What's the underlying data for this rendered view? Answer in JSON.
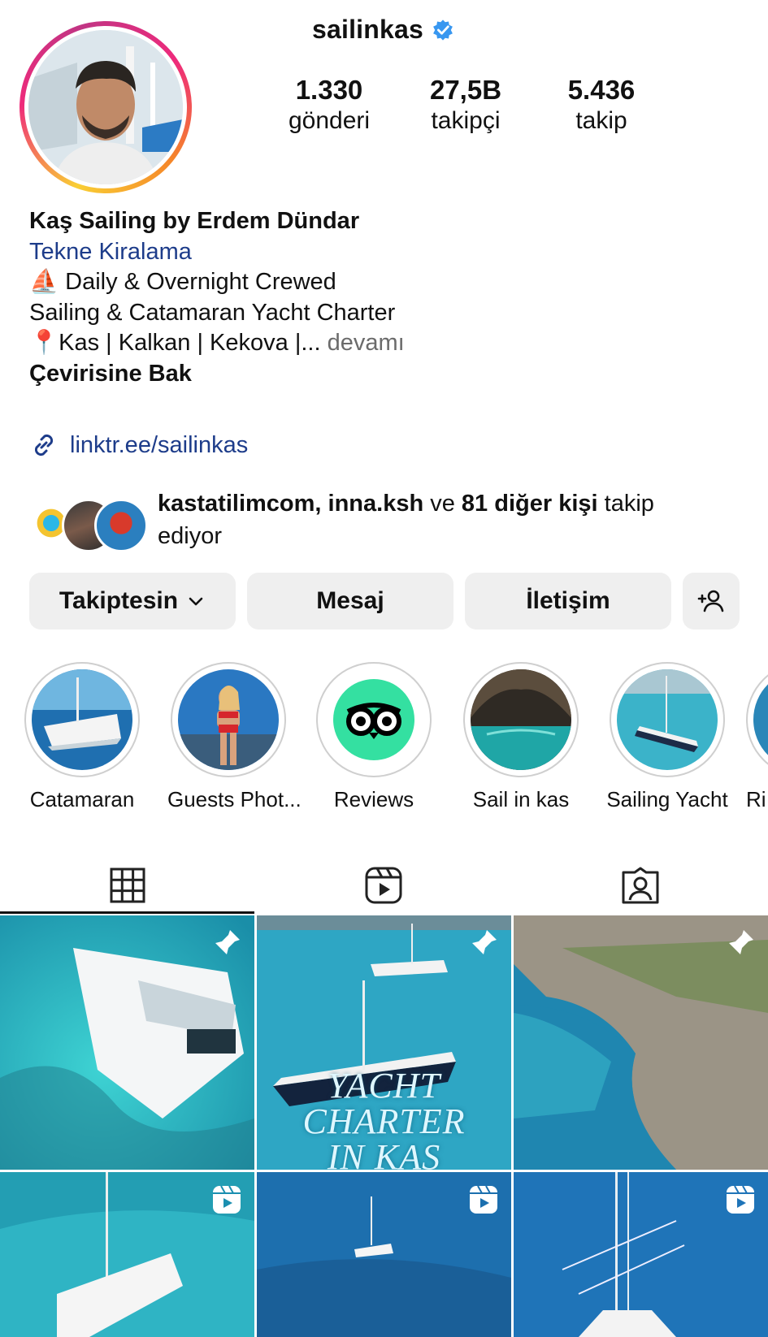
{
  "profile": {
    "username": "sailinkas",
    "verified": true,
    "stats": [
      {
        "value": "1.330",
        "label": "gönderi"
      },
      {
        "value": "27,5B",
        "label": "takipçi"
      },
      {
        "value": "5.436",
        "label": "takip"
      }
    ]
  },
  "bio": {
    "name": "Kaş Sailing by Erdem Dündar",
    "category": "Tekne Kiralama",
    "line1_icon": "sailboat-icon",
    "line1": "Daily & Overnight Crewed",
    "line2": "Sailing & Catamaran Yacht Charter",
    "line3_icon": "pin-icon",
    "line3": "Kas | Kalkan | Kekova |...",
    "more": "devamı",
    "translate": "Çevirisine Bak"
  },
  "link": {
    "icon": "link-icon",
    "text": "linktr.ee/sailinkas"
  },
  "followed_by": {
    "users": "kastatilimcom, inna.ksh",
    "connector": " ve ",
    "others": "81 diğer kişi",
    "suffix": " takip ediyor"
  },
  "buttons": {
    "following": "Takiptesin",
    "message": "Mesaj",
    "contact": "İletişim"
  },
  "highlights": [
    {
      "label": "Catamaran"
    },
    {
      "label": "Guests Phot..."
    },
    {
      "label": "Reviews"
    },
    {
      "label": "Sail in kas"
    },
    {
      "label": "Sailing Yacht"
    },
    {
      "label": "Ri"
    }
  ],
  "tabs": [
    "grid-icon",
    "reels-icon",
    "tagged-icon"
  ],
  "posts": [
    {
      "type": "pinned",
      "caption": ""
    },
    {
      "type": "pinned",
      "caption_lines": [
        "YACHT",
        "CHARTER",
        "IN KAS"
      ]
    },
    {
      "type": "pinned",
      "caption": ""
    },
    {
      "type": "reel",
      "caption": ""
    },
    {
      "type": "reel",
      "caption": ""
    },
    {
      "type": "reel",
      "caption": ""
    }
  ],
  "colors": {
    "link": "#1d3c8a",
    "verified": "#3897f0",
    "button_bg": "#efefef",
    "sea": "#2aa9c9"
  }
}
